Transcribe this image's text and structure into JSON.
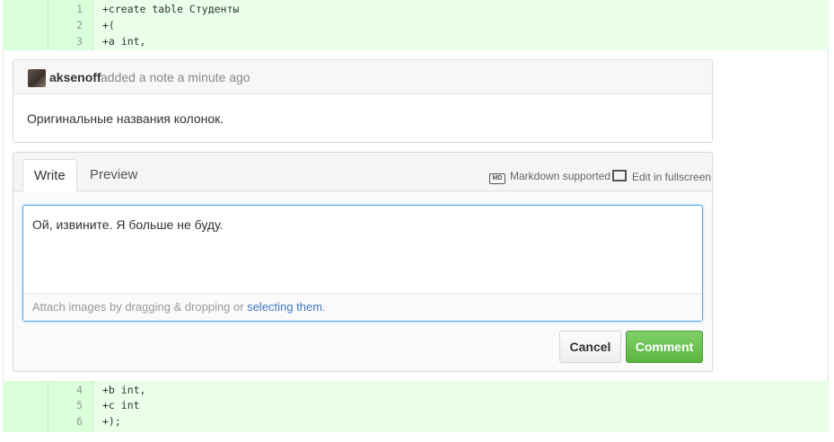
{
  "diff_top": [
    {
      "line_no": "1",
      "code": "+create table Студенты"
    },
    {
      "line_no": "2",
      "code": "+("
    },
    {
      "line_no": "3",
      "code": "+a int,"
    }
  ],
  "diff_bottom": [
    {
      "line_no": "4",
      "code": "+b int,"
    },
    {
      "line_no": "5",
      "code": "+c int"
    },
    {
      "line_no": "6",
      "code": "+);"
    }
  ],
  "note": {
    "author": "aksenoff",
    "meta": "added a note a minute ago",
    "body": "Оригинальные названия колонок."
  },
  "editor": {
    "tab_write": "Write",
    "tab_preview": "Preview",
    "markdown_icon": "MD",
    "markdown_label": "Markdown supported",
    "fullscreen_label": "Edit in fullscreen",
    "text_value": "Ой, извините. Я больше не буду.",
    "attach_prefix": "Attach images by dragging & dropping or ",
    "attach_link": "selecting them",
    "attach_suffix": ".",
    "cancel_label": "Cancel",
    "comment_label": "Comment"
  }
}
